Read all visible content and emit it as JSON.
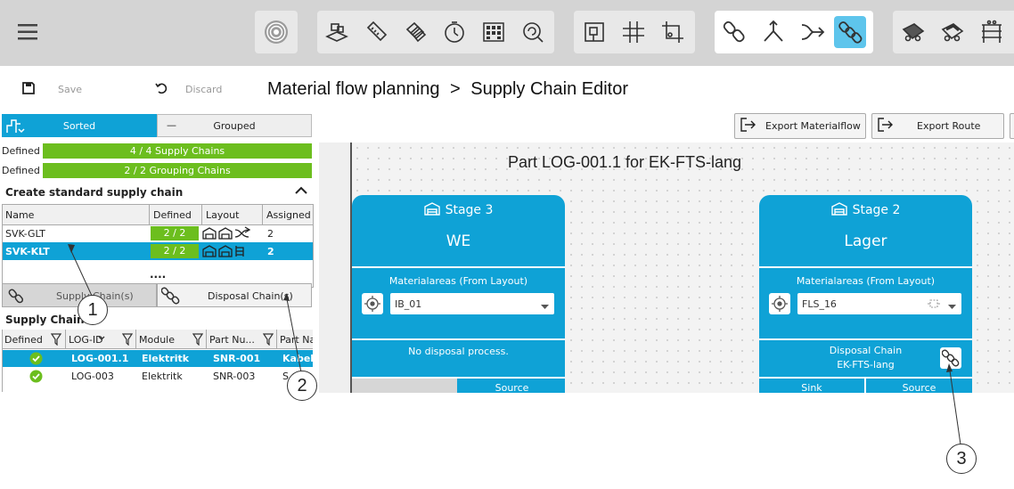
{
  "toolbar": {
    "icons": [
      "menu-icon",
      "target-icon",
      "layout-boxes-icon",
      "ruler-icon",
      "stack-icon",
      "clock-icon",
      "grid-dots-icon",
      "search-refresh-icon",
      "floorplan-icon",
      "grid-icon",
      "crop-icon",
      "chain-link-icon",
      "split-arrow-icon",
      "merge-arrow-icon",
      "supply-chain-icon",
      "forklift-icon",
      "forklift-2-icon",
      "shelf-icon"
    ],
    "active_color": "#5ec5ec"
  },
  "actions": {
    "save": "Save",
    "discard": "Discard"
  },
  "breadcrumb": {
    "root": "Material flow planning",
    "sep": ">",
    "page": "Supply Chain Editor"
  },
  "view_toggle": {
    "sorted": "Sorted",
    "grouped": "Grouped"
  },
  "status": [
    {
      "label": "Defined",
      "value": "4 / 4 Supply Chains"
    },
    {
      "label": "Defined",
      "value": "2 / 2 Grouping Chains"
    }
  ],
  "standard": {
    "title": "Create standard supply chain",
    "columns": [
      "Name",
      "Defined",
      "Layout",
      "Assigned F"
    ],
    "rows": [
      {
        "name": "SVK-GLT",
        "defined": "2 / 2",
        "assigned": "2"
      },
      {
        "name": "SVK-KLT",
        "defined": "2 / 2",
        "assigned": "2"
      }
    ],
    "more": "...."
  },
  "chain_tabs": {
    "supply": "Supply Chain(s)",
    "disposal": "Disposal Chain(s)"
  },
  "supply_chains": {
    "title": "Supply Chains",
    "columns": [
      "Defined",
      "LOG-ID",
      "Module",
      "Part Nu...",
      "Part Na"
    ],
    "rows": [
      {
        "log": "LOG-001.1",
        "module": "Elektritk",
        "part": "SNR-001",
        "name": "Kabel"
      },
      {
        "log": "LOG-003",
        "module": "Elektritk",
        "part": "SNR-003",
        "name": "S"
      }
    ]
  },
  "export": {
    "materialflow": "Export Materialflow",
    "route": "Export Route"
  },
  "canvas": {
    "title": "Part LOG-001.1 for EK-FTS-lang",
    "stage3": {
      "label": "Stage 3",
      "name": "WE",
      "areas": "Materialareas (From Layout)",
      "select": "IB_01",
      "disposal": "No disposal process.",
      "source": "Source"
    },
    "stage2": {
      "label": "Stage 2",
      "name": "Lager",
      "areas": "Materialareas (From Layout)",
      "select": "FLS_16",
      "disposal_title": "Disposal Chain",
      "disposal_name": "EK-FTS-lang",
      "sink": "Sink",
      "source": "Source"
    }
  },
  "callouts": [
    "1",
    "2",
    "3"
  ]
}
